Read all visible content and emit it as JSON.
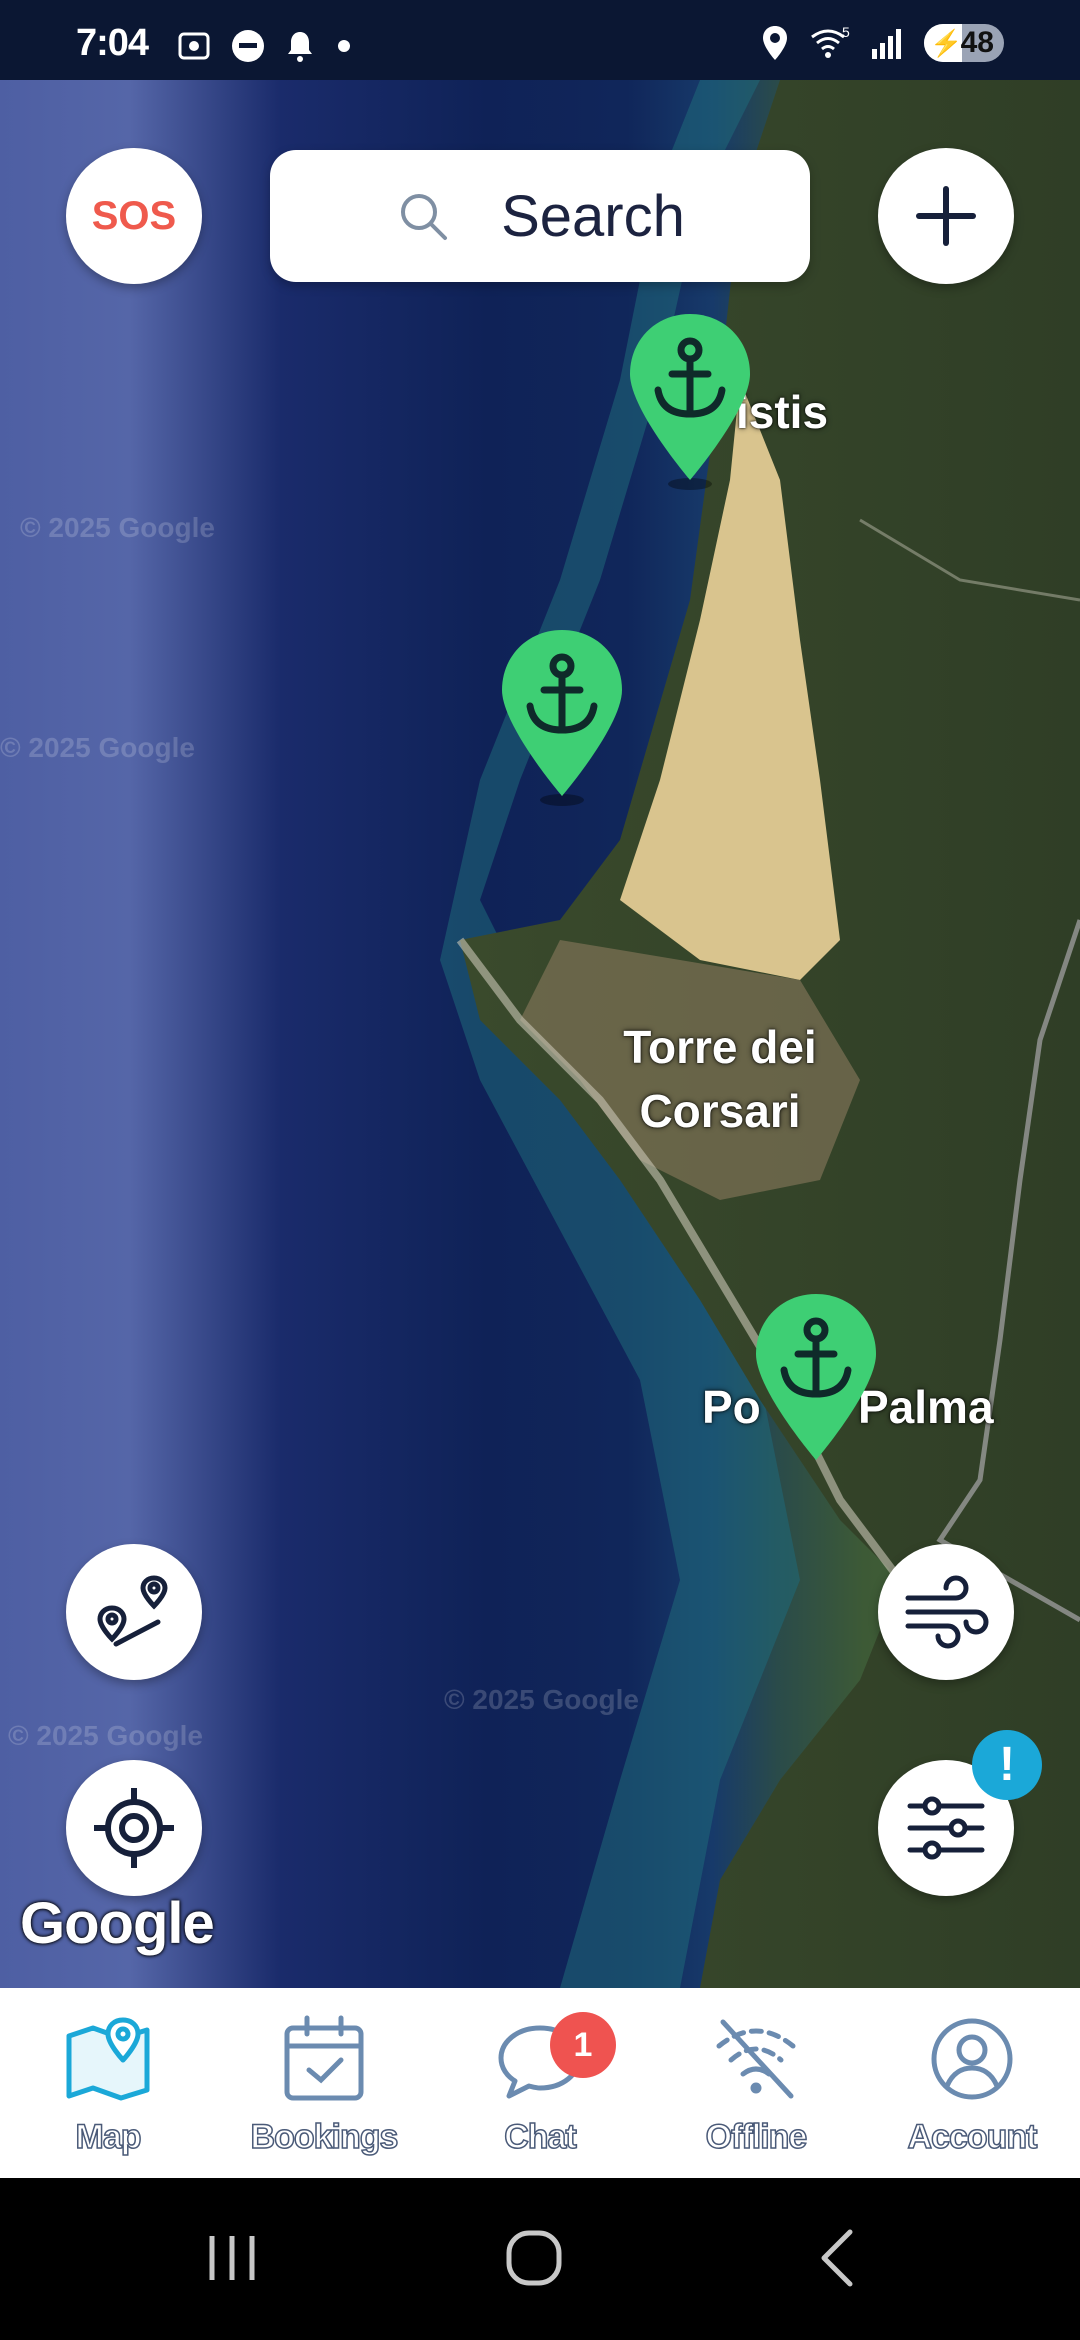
{
  "status_bar": {
    "time": "7:04",
    "battery_percent": "48",
    "network": "5"
  },
  "map": {
    "search_placeholder": "Search",
    "sos_label": "SOS",
    "places": [
      "istis",
      "Torre dei Corsari",
      "Po",
      "Palma"
    ],
    "watermark": "© 2025 Google",
    "provider_logo": "Google",
    "markers": [
      {
        "icon": "anchor-icon"
      },
      {
        "icon": "anchor-icon"
      },
      {
        "icon": "anchor-icon"
      }
    ],
    "filter_alert": "!",
    "colors": {
      "marker": "#3ecf74",
      "sos": "#ef5a4d",
      "alert_badge": "#1ba8d8",
      "chat_badge": "#ef5350",
      "nav_active": "#1ba8d8",
      "nav_inactive": "#6b8bb0"
    }
  },
  "bottom_nav": {
    "items": [
      {
        "label": "Map",
        "icon": "map-icon"
      },
      {
        "label": "Bookings",
        "icon": "calendar-check-icon"
      },
      {
        "label": "Chat",
        "icon": "chat-bubble-icon",
        "badge": "1"
      },
      {
        "label": "Offline",
        "icon": "wifi-off-icon"
      },
      {
        "label": "Account",
        "icon": "account-icon"
      }
    ]
  }
}
